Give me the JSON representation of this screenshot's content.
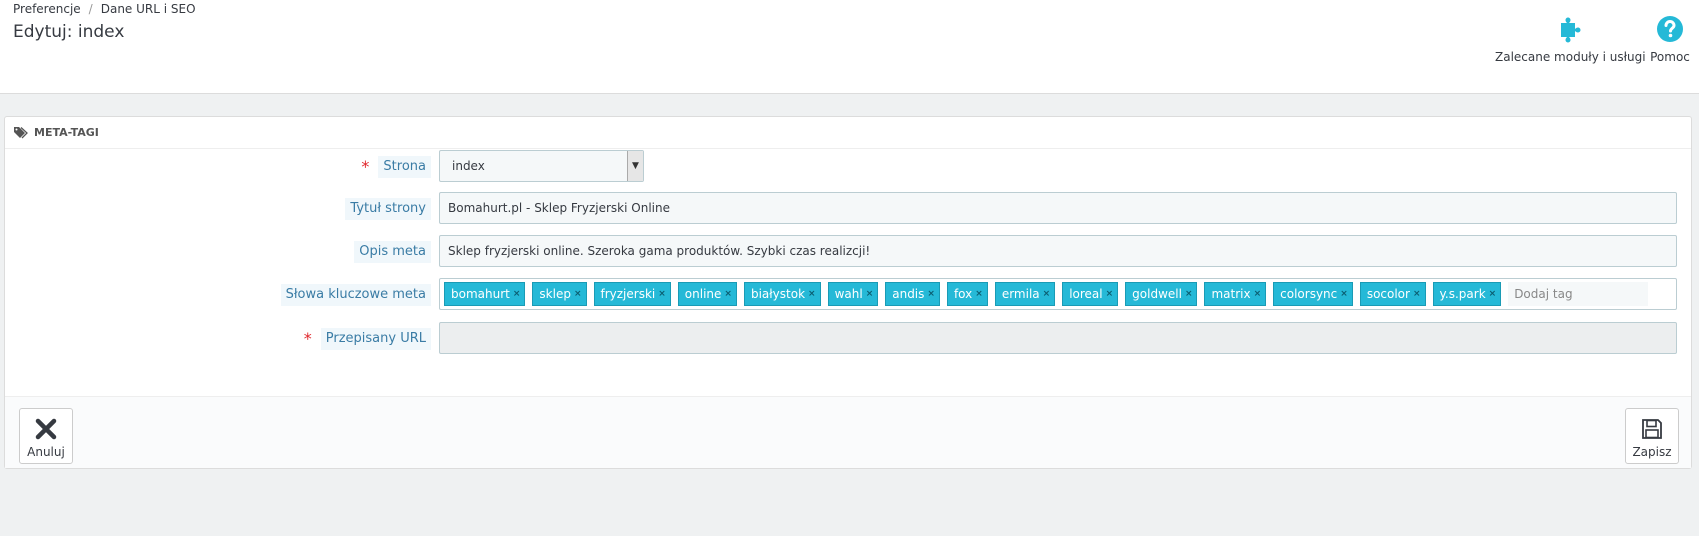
{
  "breadcrumb": {
    "parent": "Preferencje",
    "separator": "/",
    "current": "Dane URL i SEO"
  },
  "page_title": "Edytuj: index",
  "toolbar": {
    "modules_label": "Zalecane moduły i usługi",
    "help_label": "Pomoc"
  },
  "panel": {
    "heading": "META-TAGI"
  },
  "form": {
    "page": {
      "label": "Strona",
      "required": "*",
      "value": "index"
    },
    "title": {
      "label": "Tytuł strony",
      "value": "Bomahurt.pl - Sklep Fryzjerski Online"
    },
    "description": {
      "label": "Opis meta",
      "value": "Sklep fryzjerski online. Szeroka gama produktów. Szybki czas realizcji!"
    },
    "keywords": {
      "label": "Słowa kluczowe meta",
      "tags": [
        "bomahurt",
        "sklep",
        "fryzjerski",
        "online",
        "białystok",
        "wahl",
        "andis",
        "fox",
        "ermila",
        "loreal",
        "goldwell",
        "matrix",
        "colorsync",
        "socolor",
        "y.s.park"
      ],
      "tag_remove": "×",
      "placeholder": "Dodaj tag"
    },
    "rewrite_url": {
      "label": "Przepisany URL",
      "required": "*",
      "value": ""
    }
  },
  "footer": {
    "cancel_label": "Anuluj",
    "save_label": "Zapisz"
  },
  "colors": {
    "accent": "#25b9d7",
    "label_text": "#3a7ca5",
    "required": "#e0262b"
  }
}
